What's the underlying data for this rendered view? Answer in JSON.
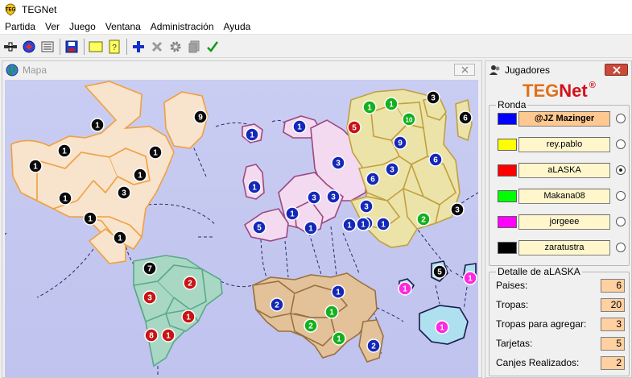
{
  "app": {
    "title": "TEGNet"
  },
  "menu": [
    "Partida",
    "Ver",
    "Juego",
    "Ventana",
    "Administración",
    "Ayuda"
  ],
  "toolbar_icons": [
    "connect-icon",
    "start-icon",
    "list-icon",
    "save-icon",
    "card-icon",
    "card-question-icon",
    "add-icon",
    "cancel-icon",
    "settings-icon",
    "copy-icon",
    "check-icon"
  ],
  "map_window": {
    "title": "Mapa"
  },
  "players_window": {
    "title": "Jugadores",
    "logo_a": "TEG",
    "logo_b": "Net",
    "logo_reg": "®",
    "round_label": "Ronda",
    "players": [
      {
        "name": "@JZ Mazinger",
        "color": "#0000ff",
        "bold": true,
        "selected": false
      },
      {
        "name": "rey.pablo",
        "color": "#ffff00",
        "bold": false,
        "selected": false
      },
      {
        "name": "aLASKA",
        "color": "#ff0000",
        "bold": false,
        "selected": true
      },
      {
        "name": "Makana08",
        "color": "#00ff00",
        "bold": false,
        "selected": false
      },
      {
        "name": "jorgeee",
        "color": "#ff00ff",
        "bold": false,
        "selected": false
      },
      {
        "name": "zaratustra",
        "color": "#000000",
        "bold": false,
        "selected": false
      }
    ],
    "detail_label": "Detalle de aLASKA",
    "details": [
      {
        "label": "Paises:",
        "value": "6"
      },
      {
        "label": "Tropas:",
        "value": "20"
      },
      {
        "label": "Tropas para agregar:",
        "value": "3"
      },
      {
        "label": "Tarjetas:",
        "value": "5"
      },
      {
        "label": "Canjes Realizados:",
        "value": "2"
      }
    ]
  },
  "colors": {
    "north_america": "#f8e3cc",
    "south_america": "#a8d8c4",
    "africa": "#e3c29a",
    "europe": "#f3daf0",
    "asia": "#ece3a8",
    "oceania": "#aee0f0",
    "ocean": "#c4c8f0"
  },
  "armies": [
    {
      "n": "1",
      "c": "black"
    },
    {
      "n": "9",
      "c": "black"
    },
    {
      "n": "1",
      "c": "black"
    },
    {
      "n": "1",
      "c": "black"
    },
    {
      "n": "1",
      "c": "black"
    },
    {
      "n": "1",
      "c": "black"
    },
    {
      "n": "3",
      "c": "black"
    },
    {
      "n": "1",
      "c": "black"
    },
    {
      "n": "1",
      "c": "black"
    },
    {
      "n": "1",
      "c": "black"
    },
    {
      "n": "7",
      "c": "black"
    },
    {
      "n": "2",
      "c": "red"
    },
    {
      "n": "3",
      "c": "red"
    },
    {
      "n": "1",
      "c": "red"
    },
    {
      "n": "8",
      "c": "red"
    },
    {
      "n": "1",
      "c": "red"
    },
    {
      "n": "1",
      "c": "blue"
    },
    {
      "n": "1",
      "c": "blue"
    },
    {
      "n": "1",
      "c": "blue"
    },
    {
      "n": "3",
      "c": "blue"
    },
    {
      "n": "1",
      "c": "blue"
    },
    {
      "n": "3",
      "c": "blue"
    },
    {
      "n": "3",
      "c": "blue"
    },
    {
      "n": "1",
      "c": "blue"
    },
    {
      "n": "1",
      "c": "blue"
    },
    {
      "n": "5",
      "c": "blue"
    },
    {
      "n": "1",
      "c": "blue"
    },
    {
      "n": "1",
      "c": "green"
    },
    {
      "n": "1",
      "c": "green"
    },
    {
      "n": "3",
      "c": "black"
    },
    {
      "n": "5",
      "c": "red"
    },
    {
      "n": "9",
      "c": "blue"
    },
    {
      "n": "10",
      "c": "green"
    },
    {
      "n": "6",
      "c": "black"
    },
    {
      "n": "3",
      "c": "blue"
    },
    {
      "n": "6",
      "c": "blue"
    },
    {
      "n": "6",
      "c": "blue"
    },
    {
      "n": "3",
      "c": "blue"
    },
    {
      "n": "1",
      "c": "blue"
    },
    {
      "n": "1",
      "c": "blue"
    },
    {
      "n": "2",
      "c": "green"
    },
    {
      "n": "3",
      "c": "black"
    },
    {
      "n": "2",
      "c": "blue"
    },
    {
      "n": "1",
      "c": "blue"
    },
    {
      "n": "1",
      "c": "green"
    },
    {
      "n": "2",
      "c": "green"
    },
    {
      "n": "1",
      "c": "green"
    },
    {
      "n": "2",
      "c": "blue"
    },
    {
      "n": "1",
      "c": "magenta"
    },
    {
      "n": "5",
      "c": "black"
    },
    {
      "n": "1",
      "c": "magenta"
    },
    {
      "n": "1",
      "c": "magenta"
    }
  ]
}
